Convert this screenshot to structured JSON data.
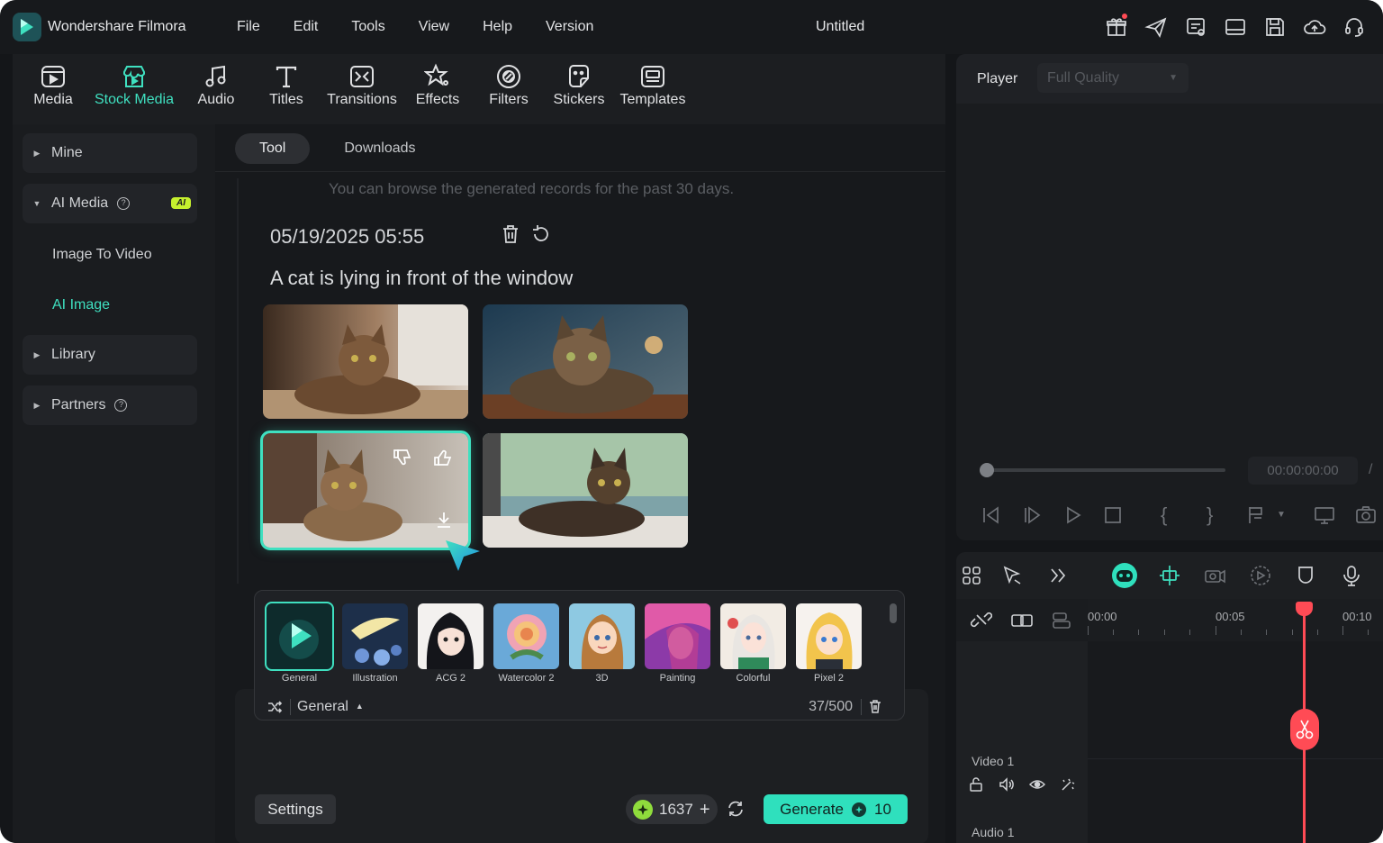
{
  "app": {
    "name": "Wondershare Filmora",
    "doc_title": "Untitled"
  },
  "menu": [
    "File",
    "Edit",
    "Tools",
    "View",
    "Help",
    "Version"
  ],
  "toolbar_tabs": [
    {
      "label": "Media",
      "icon": "media-icon"
    },
    {
      "label": "Stock Media",
      "icon": "stock-media-icon",
      "active": true
    },
    {
      "label": "Audio",
      "icon": "audio-icon"
    },
    {
      "label": "Titles",
      "icon": "titles-icon"
    },
    {
      "label": "Transitions",
      "icon": "transitions-icon"
    },
    {
      "label": "Effects",
      "icon": "effects-icon"
    },
    {
      "label": "Filters",
      "icon": "filters-icon"
    },
    {
      "label": "Stickers",
      "icon": "stickers-icon"
    },
    {
      "label": "Templates",
      "icon": "templates-icon"
    }
  ],
  "sidebar": {
    "mine": "Mine",
    "ai_media": "AI Media",
    "ai_badge": "AI",
    "image_to_video": "Image To Video",
    "ai_image": "AI Image",
    "library": "Library",
    "partners": "Partners"
  },
  "subtabs": {
    "tool": "Tool",
    "downloads": "Downloads"
  },
  "notice": "You can browse the generated records for the past 30 days.",
  "record": {
    "date": "05/19/2025 05:55",
    "prompt": "A cat is lying in front of the window"
  },
  "styles": {
    "items": [
      "General",
      "Illustration",
      "ACG 2",
      "Watercolor 2",
      "3D",
      "Painting",
      "Colorful",
      "Pixel 2"
    ],
    "selected": "General",
    "char_count": "37/500"
  },
  "buttons": {
    "settings": "Settings",
    "credits": "1637",
    "generate": "Generate",
    "generate_cost": "10"
  },
  "player": {
    "title": "Player",
    "quality": "Full Quality",
    "timecode": "00:00:00:00",
    "slash": "/"
  },
  "timeline": {
    "ruler": [
      "00:00",
      "00:05",
      "00:10"
    ],
    "video_track": "Video 1",
    "audio_track": "Audio 1"
  },
  "colors": {
    "accent": "#3fe0c0",
    "playhead": "#ff4b55",
    "bg": "#141619"
  }
}
